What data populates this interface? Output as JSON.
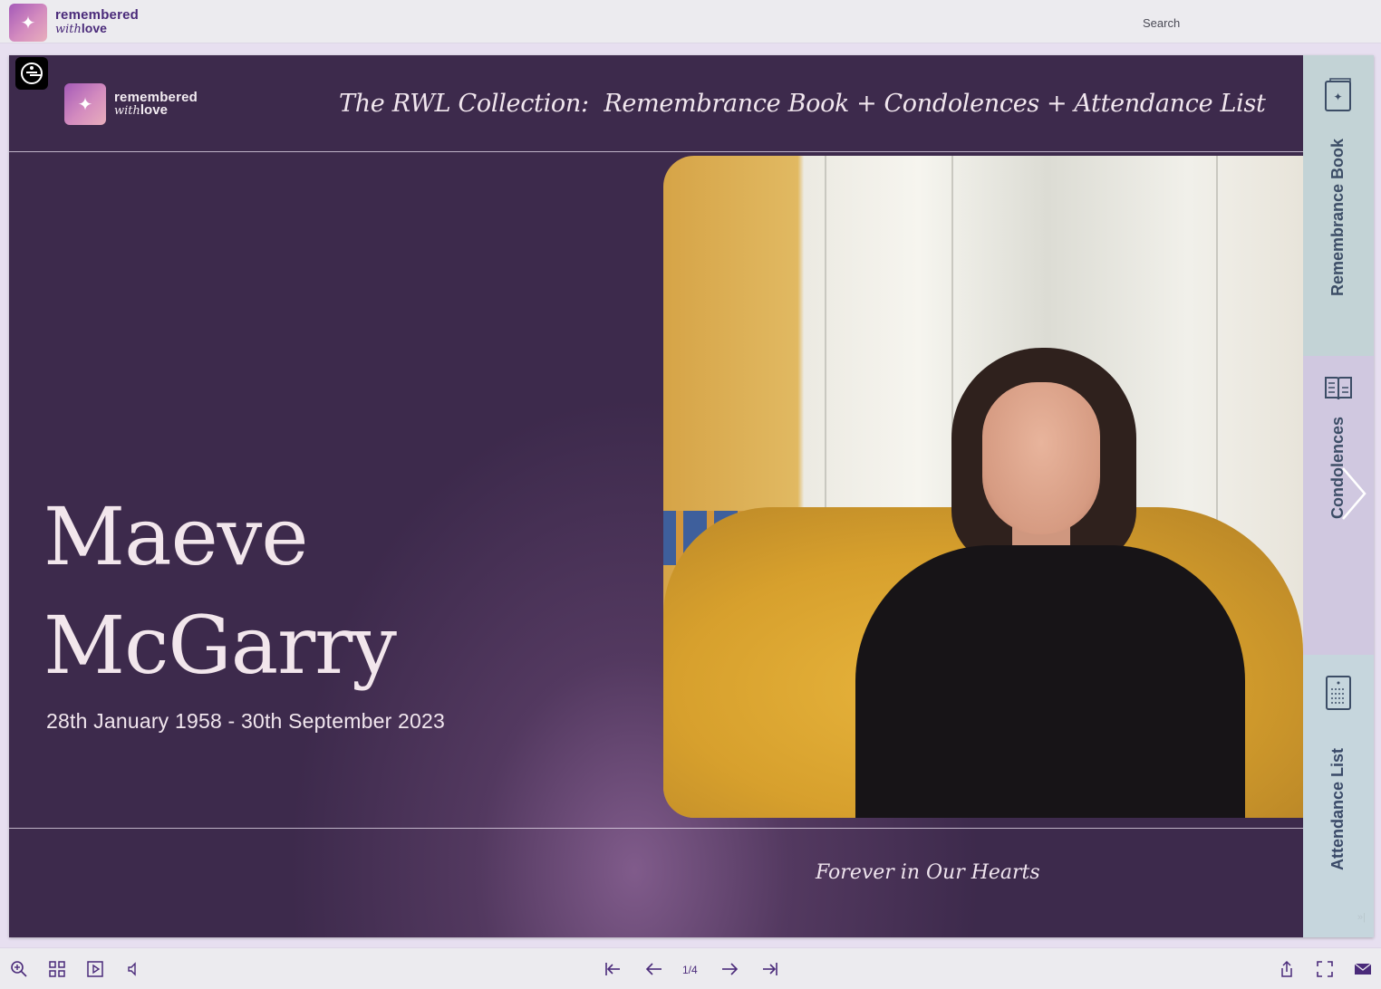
{
  "app": {
    "logo": {
      "line1": "remembered",
      "line2_italic": "with",
      "line2_bold": "love",
      "mark": "✦"
    },
    "search_label": "Search"
  },
  "page": {
    "logo": {
      "line1": "remembered",
      "line2_italic": "with",
      "line2_bold": "love",
      "mark": "✦"
    },
    "collection_title": {
      "prefix": "The RWL Collection:",
      "part1": "Remembrance Book",
      "part2": "Condolences",
      "part3": "Attendance List",
      "plus": "+"
    },
    "first_name": "Maeve",
    "last_name": "McGarry",
    "dates": "28th January 1958 - 30th September 2023",
    "footer": "Forever in Our Hearts"
  },
  "tabs": [
    {
      "label": "Remembrance Book",
      "icon": "book-star-icon",
      "color": "#c3d3d6"
    },
    {
      "label": "Condolences",
      "icon": "open-book-icon",
      "color": "#d0c8e0"
    },
    {
      "label": "Attendance List",
      "icon": "list-document-icon",
      "color": "#c6d6dd"
    }
  ],
  "toolbar": {
    "page_indicator": "1/4",
    "left_icons": [
      "zoom-icon",
      "thumbnails-icon",
      "play-icon",
      "sound-icon"
    ],
    "nav_icons": [
      "first-page-icon",
      "prev-page-icon",
      "next-page-icon",
      "last-page-icon"
    ],
    "right_icons": [
      "share-icon",
      "fullscreen-icon",
      "mail-icon"
    ]
  },
  "colors": {
    "page_bg": "#3d2a4c",
    "brand_purple": "#4a2a7a",
    "tab_label": "#3c4d66"
  }
}
